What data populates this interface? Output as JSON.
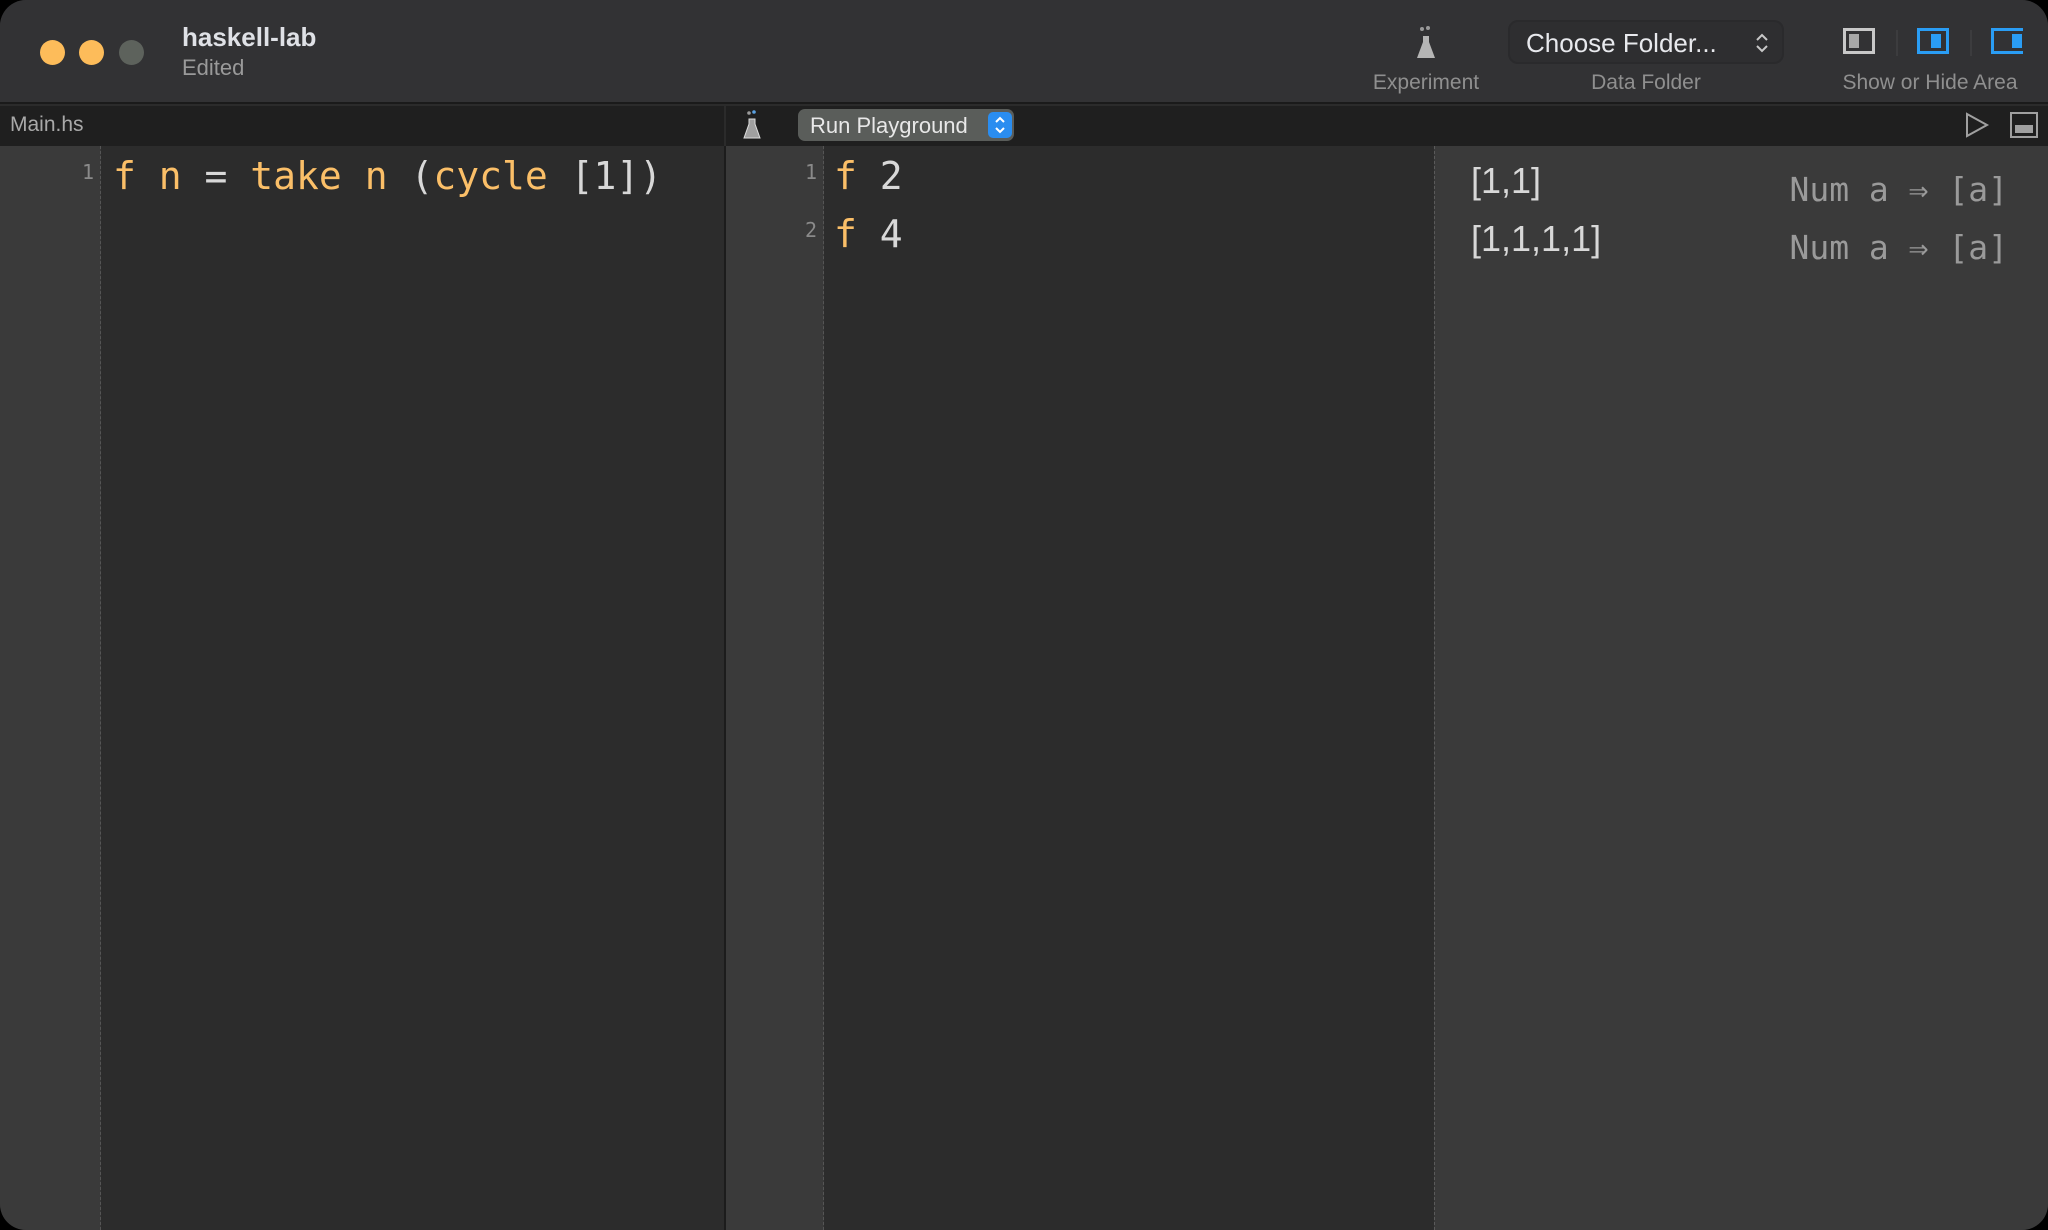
{
  "window": {
    "title": "haskell-lab",
    "subtitle": "Edited",
    "traffic_lights": [
      "close",
      "minimize",
      "zoom"
    ]
  },
  "toolbar": {
    "experiment_label": "Experiment",
    "experiment_icon": "flask-icon",
    "data_folder_label": "Data Folder",
    "data_folder_value": "Choose Folder...",
    "show_hide_label": "Show or Hide Area",
    "area_buttons": [
      {
        "name": "navigator",
        "active": false
      },
      {
        "name": "editor",
        "active": true
      },
      {
        "name": "inspector",
        "active": true
      }
    ],
    "accent_color": "#2a9df4"
  },
  "left_pane": {
    "tab_label": "Main.hs",
    "lines": [
      {
        "number": "1",
        "tokens": [
          {
            "text": "f",
            "kind": "kw"
          },
          {
            "text": " n ",
            "kind": "kw"
          },
          {
            "text": "=",
            "kind": "op"
          },
          {
            "text": " take n ",
            "kind": "kw"
          },
          {
            "text": "(",
            "kind": "op"
          },
          {
            "text": "cycle",
            "kind": "kw"
          },
          {
            "text": " [1])",
            "kind": "op"
          }
        ]
      }
    ]
  },
  "playground": {
    "run_mode": "Run Playground",
    "lines": [
      {
        "number": "1",
        "fn": "f",
        "arg": " 2"
      },
      {
        "number": "2",
        "fn": "f",
        "arg": " 4"
      }
    ],
    "results": [
      {
        "value": "[1,1]",
        "type": "Num a ⇒ [a]"
      },
      {
        "value": "[1,1,1,1]",
        "type": "Num a ⇒ [a]"
      }
    ]
  }
}
